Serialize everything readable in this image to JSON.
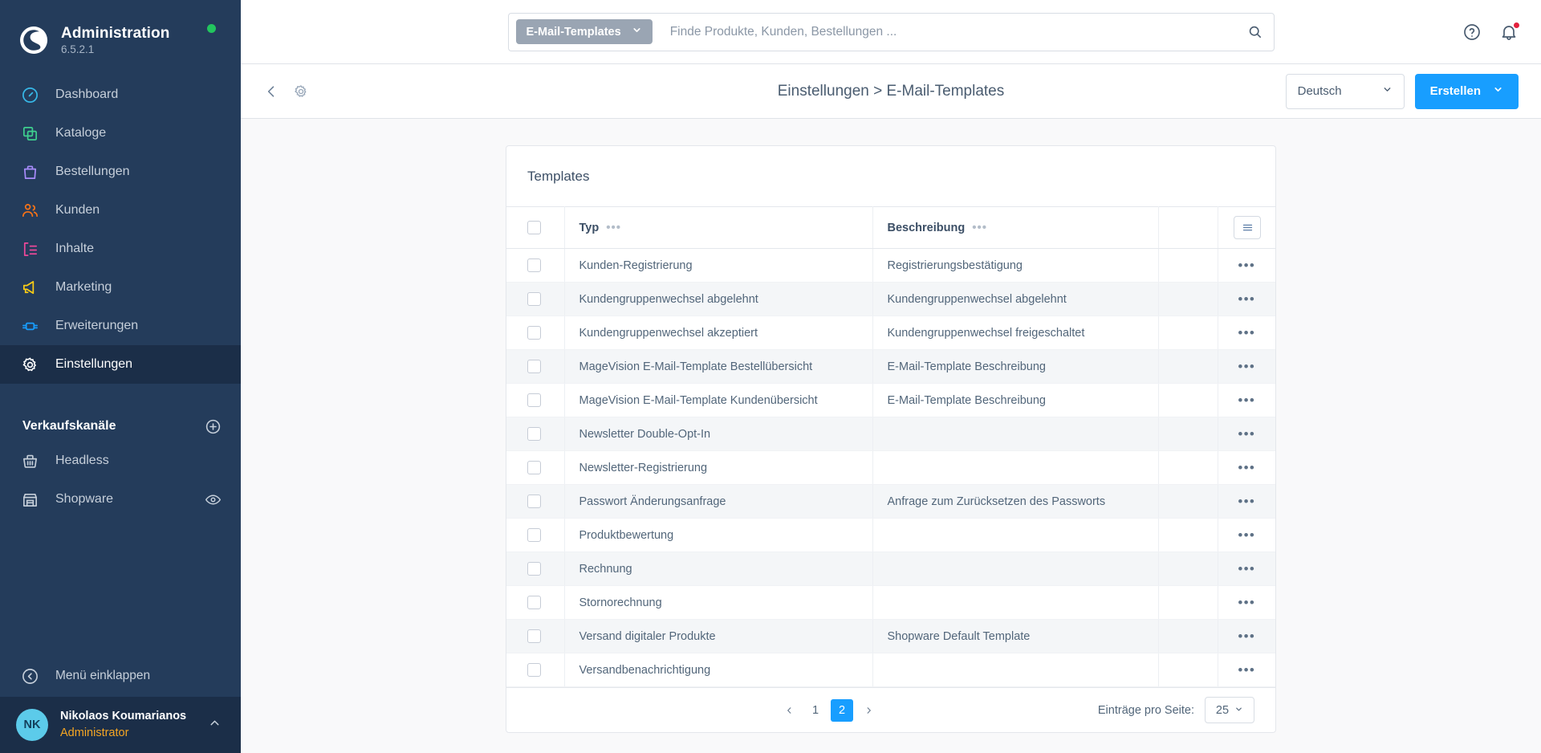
{
  "sidebar": {
    "brand": {
      "title": "Administration",
      "version": "6.5.2.1",
      "status_color": "#22c55e"
    },
    "items": [
      {
        "label": "Dashboard",
        "icon": "dashboard-icon",
        "color": "#37b8e8",
        "active": false
      },
      {
        "label": "Kataloge",
        "icon": "catalog-icon",
        "color": "#3ecf8e",
        "active": false
      },
      {
        "label": "Bestellungen",
        "icon": "orders-bag-icon",
        "color": "#a78bfa",
        "active": false
      },
      {
        "label": "Kunden",
        "icon": "customers-icon",
        "color": "#f97316",
        "active": false
      },
      {
        "label": "Inhalte",
        "icon": "content-icon",
        "color": "#ec4899",
        "active": false
      },
      {
        "label": "Marketing",
        "icon": "megaphone-icon",
        "color": "#facc15",
        "active": false
      },
      {
        "label": "Erweiterungen",
        "icon": "plugin-icon",
        "color": "#189eff",
        "active": false
      },
      {
        "label": "Einstellungen",
        "icon": "gear-icon",
        "color": "#ffffff",
        "active": true
      }
    ],
    "section": {
      "title": "Verkaufskanäle",
      "add_icon": "plus-circle-icon"
    },
    "channels": [
      {
        "label": "Headless",
        "icon": "basket-icon",
        "has_eye": false
      },
      {
        "label": "Shopware",
        "icon": "storefront-icon",
        "has_eye": true
      }
    ],
    "collapse": {
      "label": "Menü einklappen",
      "icon": "collapse-left-icon"
    },
    "user": {
      "initials": "NK",
      "name": "Nikolaos Koumarianos",
      "role": "Administrator",
      "caret": "chevron-up-icon"
    }
  },
  "topbar": {
    "search": {
      "scope_label": "E-Mail-Templates",
      "placeholder": "Finde Produkte, Kunden, Bestellungen ...",
      "value": ""
    },
    "help_icon": "help-circle-icon",
    "notification_icon": "bell-icon",
    "has_notification": true
  },
  "toolbar": {
    "back_icon": "chevron-left-icon",
    "settings_icon": "gear-icon",
    "breadcrumb": "Einstellungen > E-Mail-Templates",
    "language": "Deutsch",
    "create_label": "Erstellen",
    "accent_color": "#189eff"
  },
  "card": {
    "title": "Templates",
    "columns": [
      {
        "label": "Typ"
      },
      {
        "label": "Beschreibung"
      }
    ],
    "settings_icon": "list-settings-icon",
    "rows": [
      {
        "typ": "Kunden-Registrierung",
        "beschreibung": "Registrierungsbestätigung"
      },
      {
        "typ": "Kundengruppenwechsel abgelehnt",
        "beschreibung": "Kundengruppenwechsel abgelehnt"
      },
      {
        "typ": "Kundengruppenwechsel akzeptiert",
        "beschreibung": "Kundengruppenwechsel freigeschaltet"
      },
      {
        "typ": "MageVision E-Mail-Template Bestellübersicht",
        "beschreibung": "E-Mail-Template Beschreibung"
      },
      {
        "typ": "MageVision E-Mail-Template Kundenübersicht",
        "beschreibung": "E-Mail-Template Beschreibung"
      },
      {
        "typ": "Newsletter Double-Opt-In",
        "beschreibung": ""
      },
      {
        "typ": "Newsletter-Registrierung",
        "beschreibung": ""
      },
      {
        "typ": "Passwort Änderungsanfrage",
        "beschreibung": "Anfrage zum Zurücksetzen des Passworts"
      },
      {
        "typ": "Produktbewertung",
        "beschreibung": ""
      },
      {
        "typ": "Rechnung",
        "beschreibung": ""
      },
      {
        "typ": "Stornorechnung",
        "beschreibung": ""
      },
      {
        "typ": "Versand digitaler Produkte",
        "beschreibung": "Shopware Default Template"
      },
      {
        "typ": "Versandbenachrichtigung",
        "beschreibung": ""
      }
    ],
    "pagination": {
      "pages": [
        "1",
        "2"
      ],
      "current": "2",
      "per_page_label": "Einträge pro Seite:",
      "per_page_value": "25"
    }
  }
}
